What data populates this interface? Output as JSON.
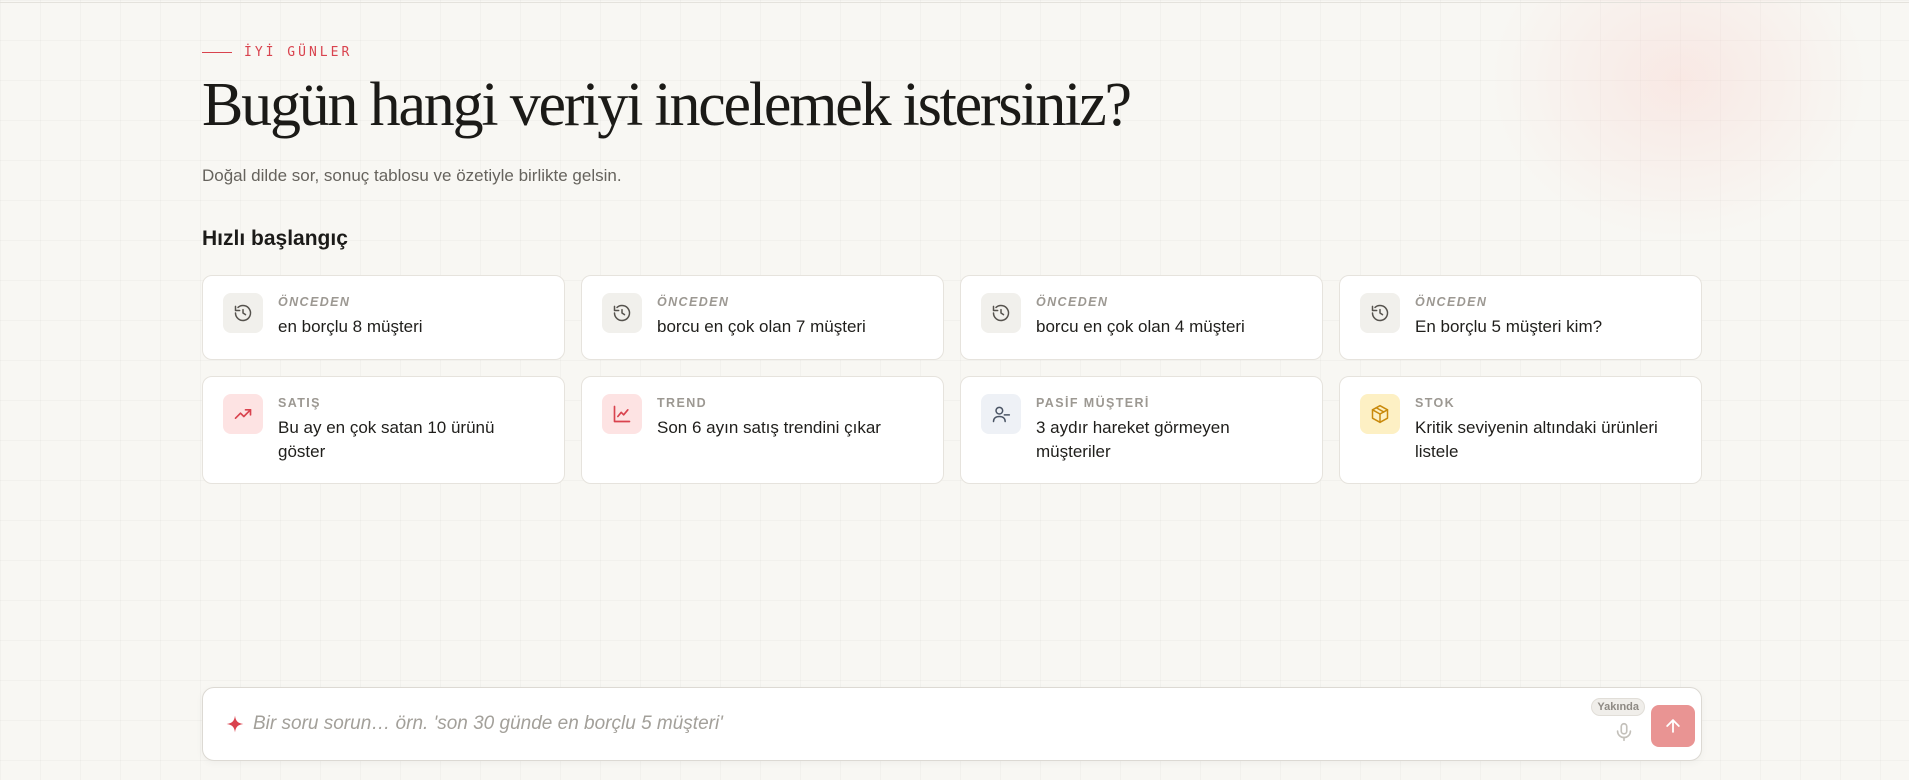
{
  "hero": {
    "eyebrow": "İYİ GÜNLER",
    "title": "Bugün hangi veriyi incelemek istersiniz?",
    "subtitle": "Doğal dilde sor, sonuç tablosu ve özetiyle birlikte gelsin."
  },
  "quick_start": {
    "title": "Hızlı başlangıç",
    "recent": [
      {
        "tag": "ÖNCEDEN",
        "text": "en borçlu 8 müşteri",
        "icon": "history-icon"
      },
      {
        "tag": "ÖNCEDEN",
        "text": "borcu en çok olan 7 müşteri",
        "icon": "history-icon"
      },
      {
        "tag": "ÖNCEDEN",
        "text": "borcu en çok olan 4 müşteri",
        "icon": "history-icon"
      },
      {
        "tag": "ÖNCEDEN",
        "text": "En borçlu 5 müşteri kim?",
        "icon": "history-icon"
      }
    ],
    "suggestions": [
      {
        "tag": "SATIŞ",
        "text": "Bu ay en çok satan 10 ürünü göster",
        "icon": "trending-up-icon"
      },
      {
        "tag": "TREND",
        "text": "Son 6 ayın satış trendini çıkar",
        "icon": "line-chart-icon"
      },
      {
        "tag": "PASİF MÜŞTERİ",
        "text": "3 aydır hareket görmeyen müşteriler",
        "icon": "user-minus-icon"
      },
      {
        "tag": "STOK",
        "text": "Kritik seviyenin altındaki ürünleri listele",
        "icon": "package-icon"
      }
    ]
  },
  "composer": {
    "placeholder": "Bir soru sorun… örn. 'son 30 günde en borçlu 5 müşteri'",
    "soon_badge": "Yakında",
    "icons": [
      "sparkle-icon",
      "microphone-icon",
      "arrow-up-icon"
    ]
  },
  "colors": {
    "accent": "#d9434e",
    "send_button": "#e99493",
    "background": "#f8f7f3",
    "card_border": "#e6e3dd",
    "sales_icon_bg": "#fde3e3",
    "trend_icon_bg": "#fde3e3",
    "passive_icon_bg": "#eef1f6",
    "stock_icon_bg": "#fdf0c4",
    "history_icon_bg": "#f1f0ec"
  }
}
